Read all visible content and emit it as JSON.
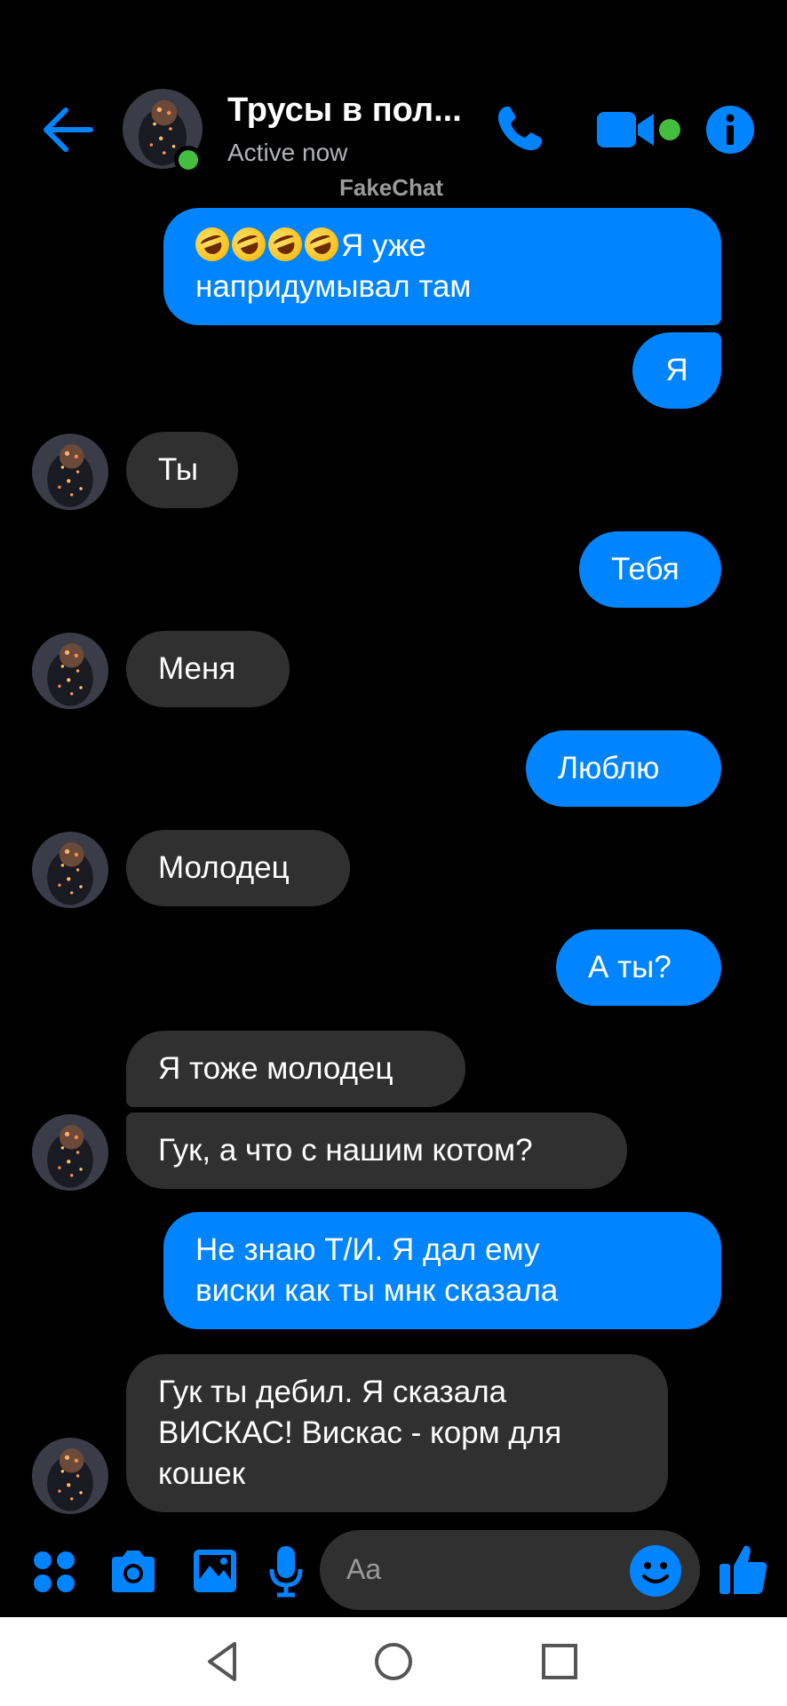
{
  "header": {
    "contact_name": "Трусы в пол...",
    "status": "Active now",
    "watermark": "FakeChat"
  },
  "icons": {
    "back": "back-arrow-icon",
    "phone": "phone-icon",
    "video": "video-camera-icon",
    "info": "info-icon",
    "apps": "apps-grid-icon",
    "camera": "camera-icon",
    "gallery": "gallery-icon",
    "mic": "microphone-icon",
    "emoji": "smiley-icon",
    "like": "thumbs-up-icon"
  },
  "colors": {
    "accent": "#0084ff",
    "incoming_bubble": "#303030",
    "online": "#45bd3f"
  },
  "messages": [
    {
      "direction": "outgoing",
      "emoji_prefix": "🤣🤣🤣🤣",
      "line1": "Я уже",
      "line2": "напридумывал там"
    },
    {
      "direction": "outgoing",
      "text": "Я"
    },
    {
      "direction": "incoming",
      "text": "Ты"
    },
    {
      "direction": "outgoing",
      "text": "Тебя"
    },
    {
      "direction": "incoming",
      "text": "Меня"
    },
    {
      "direction": "outgoing",
      "text": "Люблю"
    },
    {
      "direction": "incoming",
      "text": "Молодец"
    },
    {
      "direction": "outgoing",
      "text": "А ты?"
    },
    {
      "direction": "incoming",
      "text": "Я тоже молодец"
    },
    {
      "direction": "incoming",
      "text": "Гук, а что с нашим котом?"
    },
    {
      "direction": "outgoing",
      "line1": "Не знаю Т/И. Я дал ему",
      "line2": "виски как ты мнк сказала"
    },
    {
      "direction": "incoming",
      "line1": "Гук ты дебил. Я сказала",
      "line2": "ВИСКАС! Вискас - корм для",
      "line3": "кошек"
    }
  ],
  "composer": {
    "placeholder": "Aa"
  }
}
